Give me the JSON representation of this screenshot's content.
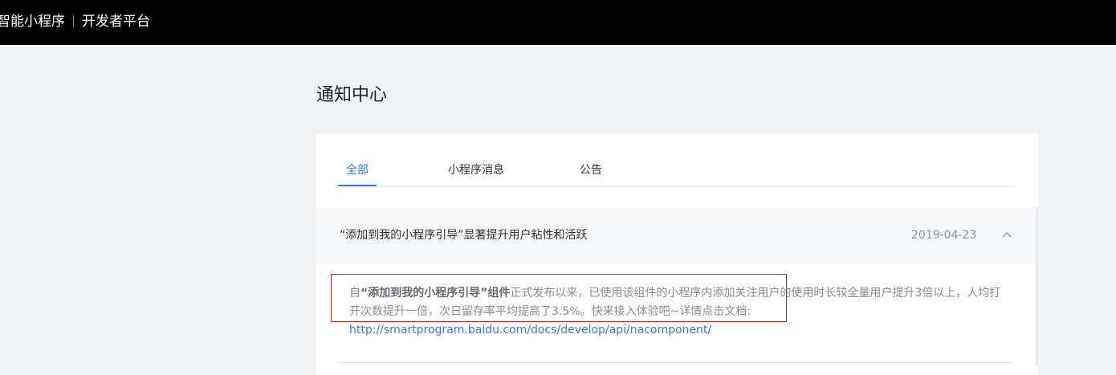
{
  "header": {
    "brand_left": "智能小程序",
    "brand_right": "开发者平台"
  },
  "page": {
    "title": "通知中心"
  },
  "tabs": [
    {
      "label": "全部",
      "active": true
    },
    {
      "label": "小程序消息",
      "active": false
    },
    {
      "label": "公告",
      "active": false
    }
  ],
  "notices": [
    {
      "title": "“添加到我的小程序引导”显著提升用户粘性和活跃",
      "date": "2019-04-23",
      "expanded": true,
      "body_prefix": "自",
      "body_bold": "“添加到我的小程序引导”组件",
      "body_line1": "正式发布以来，已使用该组件的小程序内添加关注用户的使用时长较全量用户提升3倍以上，人均打",
      "body_line2": "开次数提升一倍，次日留存率平均提高了3.5%。快来接入体验吧~详情点击文档:",
      "link": "http://smartprogram.baidu.com/docs/develop/api/nacomponent/"
    }
  ],
  "colors": {
    "topbar": "#000000",
    "accent": "#3c76e0",
    "highlight_box": "#c62828",
    "background": "#f2f3f5"
  },
  "icons": {
    "collapse": "chevron-up-icon"
  }
}
